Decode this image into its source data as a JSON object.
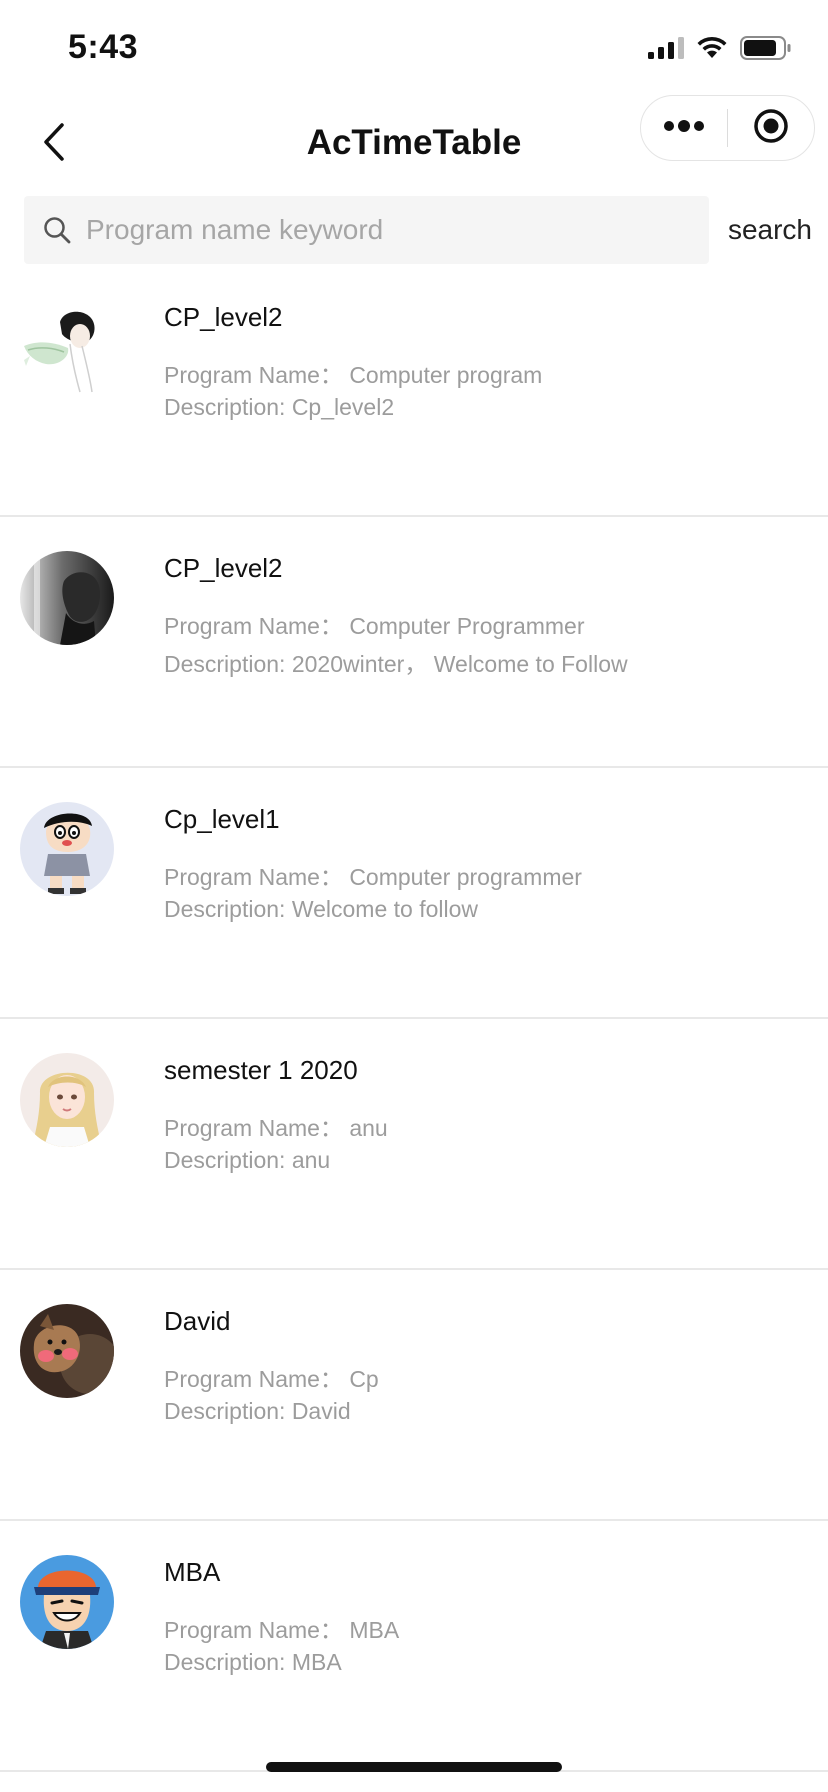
{
  "status_bar": {
    "time": "5:43",
    "icons": [
      "cellular-signal-icon",
      "wifi-icon",
      "battery-icon"
    ]
  },
  "nav": {
    "title": "AcTimeTable",
    "icons": [
      "back-chevron-icon",
      "more-dots-icon",
      "target-circle-icon"
    ]
  },
  "search": {
    "placeholder": "Program name keyword",
    "value": "",
    "button_label": "search"
  },
  "programs": [
    {
      "title": "CP_level2",
      "program_name": "Program Name：  Computer program",
      "description": "Description: Cp_level2",
      "avatar": "avatar-anime-boy-icon"
    },
    {
      "title": "CP_level2",
      "program_name": "Program Name：  Computer Programmer",
      "description": "Description: 2020winter，  Welcome to Follow",
      "avatar": "avatar-bw-profile-icon"
    },
    {
      "title": "Cp_level1",
      "program_name": "Program Name：  Computer programmer",
      "description": "Description: Welcome to follow",
      "avatar": "avatar-cartoon-kid-icon"
    },
    {
      "title": "semester 1 2020",
      "program_name": "Program Name：  anu",
      "description": "Description: anu",
      "avatar": "avatar-blonde-girl-icon"
    },
    {
      "title": "David",
      "program_name": "Program Name：  Cp",
      "description": "Description: David",
      "avatar": "avatar-dog-icon"
    },
    {
      "title": "MBA",
      "program_name": "Program Name：  MBA",
      "description": "Description: MBA",
      "avatar": "avatar-cartoon-cap-icon"
    }
  ],
  "colors": {
    "secondary_text": "#9c9c9c",
    "search_bg": "#f5f5f5",
    "divider": "#e8e8e8"
  }
}
